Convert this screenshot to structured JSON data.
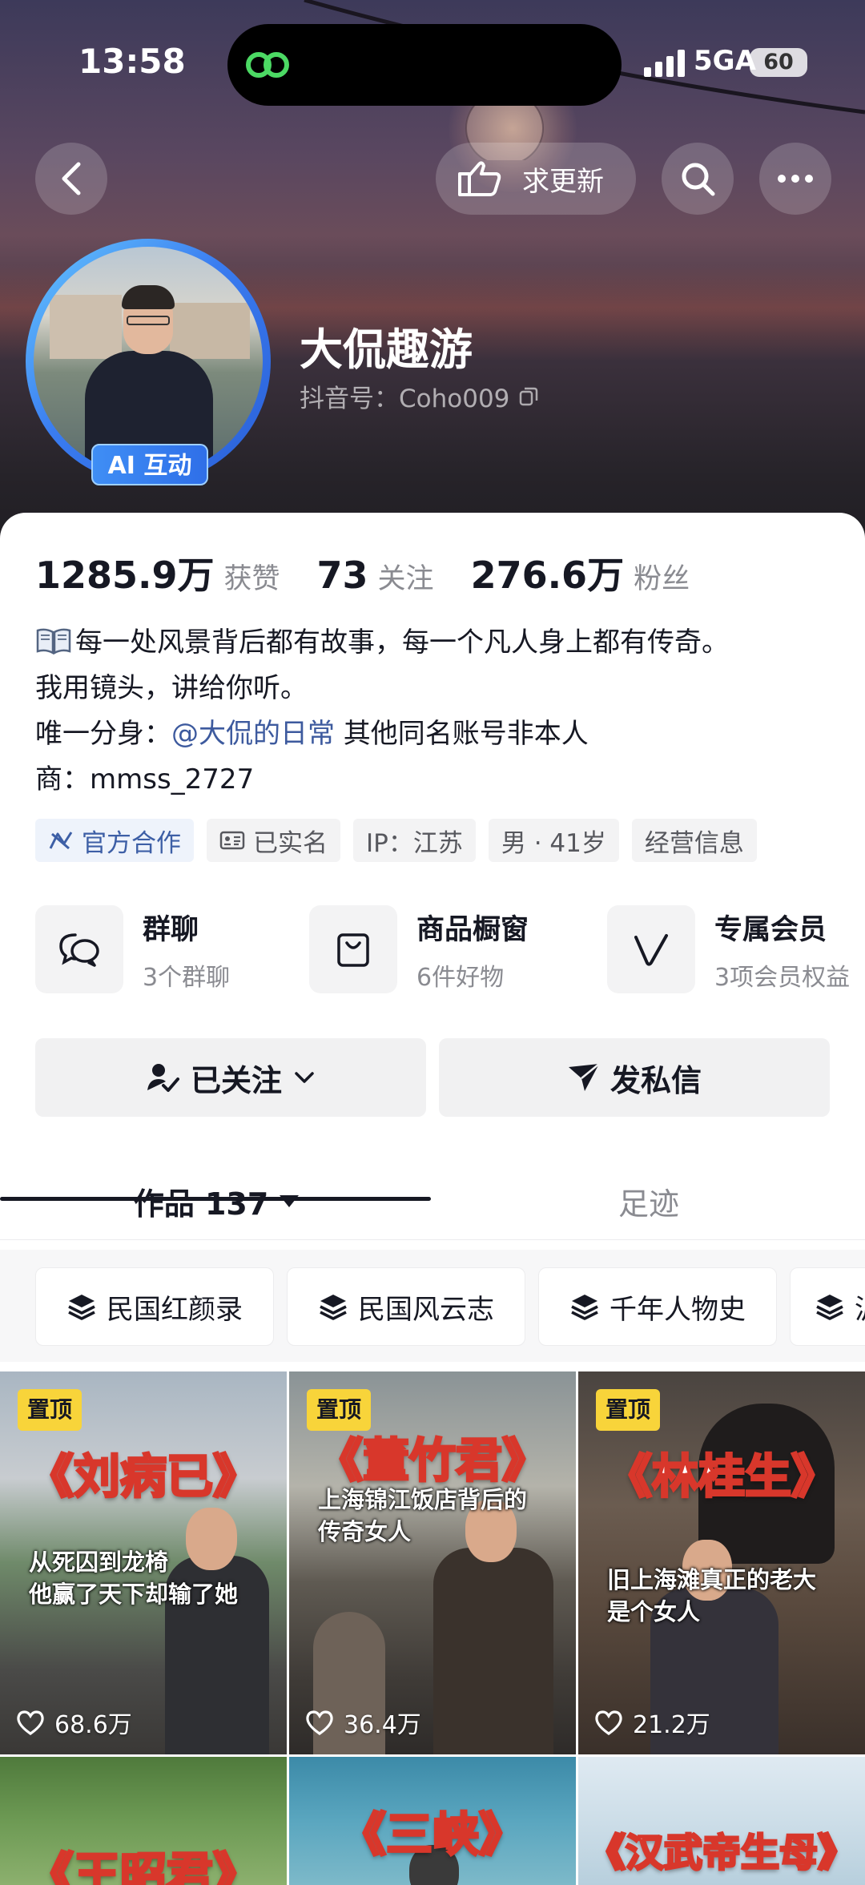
{
  "status_bar": {
    "time": "13:58",
    "network": "5GA",
    "battery": "60"
  },
  "header": {
    "update_label": "求更新"
  },
  "profile": {
    "avatar_badge": "AI 互动",
    "name": "大侃趣游",
    "douyin_id": "抖音号：Coho009"
  },
  "stats": [
    {
      "value": "1285.9万",
      "label": "获赞"
    },
    {
      "value": "73",
      "label": "关注"
    },
    {
      "value": "276.6万",
      "label": "粉丝"
    }
  ],
  "bio": {
    "line1": "每一处风景背后都有故事，每一个凡人身上都有传奇。",
    "line2": "我用镜头，讲给你听。",
    "line3_prefix": "唯一分身：",
    "line3_mention": "@大侃的日常",
    "line3_suffix": " 其他同名账号非本人",
    "line4": "商：mmss_2727"
  },
  "tags": [
    "官方合作",
    "已实名",
    "IP：江苏",
    "男 · 41岁",
    "经营信息"
  ],
  "features": [
    {
      "title": "群聊",
      "subtitle": "3个群聊",
      "icon": "chat-bubbles-icon"
    },
    {
      "title": "商品橱窗",
      "subtitle": "6件好物",
      "icon": "shopping-bag-icon"
    },
    {
      "title": "专属会员",
      "subtitle": "3项会员权益",
      "icon": "vip-v-icon"
    }
  ],
  "actions": {
    "follow": "已关注",
    "message": "发私信"
  },
  "tabs": {
    "works": "作品 137",
    "footprint": "足迹"
  },
  "collections": [
    "民国红颜录",
    "民国风云志",
    "千年人物史",
    "沪"
  ],
  "videos": [
    {
      "pinned": "置顶",
      "title": "《刘病已》",
      "caption1": "从死囚到龙椅",
      "caption2": "他赢了天下却输了她",
      "likes": "68.6万"
    },
    {
      "pinned": "置顶",
      "title": "《董竹君》",
      "caption1": "上海锦江饭店背后的",
      "caption2": "传奇女人",
      "likes": "36.4万"
    },
    {
      "pinned": "置顶",
      "title": "《林桂生》",
      "caption1": "旧上海滩真正的老大",
      "caption2": "是个女人",
      "likes": "21.2万"
    },
    {
      "title": "《王昭君》"
    },
    {
      "title": "《三峡》"
    },
    {
      "title": "《汉武帝生母》"
    }
  ],
  "colors": {
    "accent_yellow": "#f8d43a",
    "mention_blue": "#3d5a9e",
    "title_red": "#d8372b",
    "ai_badge_blue": "#2f6fe8"
  }
}
